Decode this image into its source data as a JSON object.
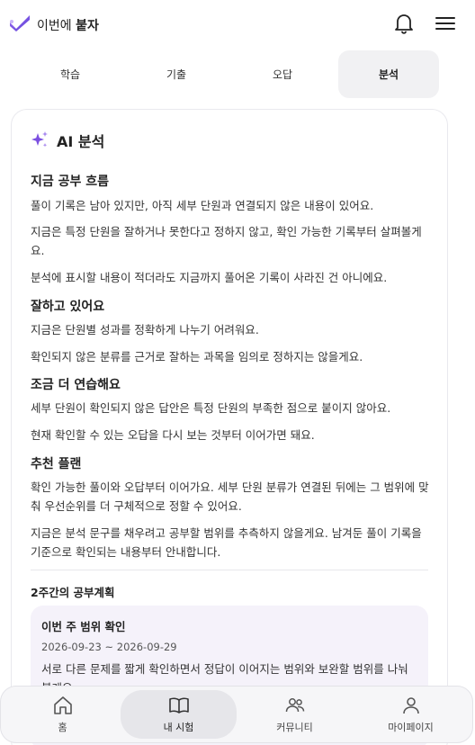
{
  "header": {
    "logo_prefix": "이번에",
    "logo_bold": "붙자",
    "bell_icon": "bell-icon",
    "menu_icon": "hamburger-menu-icon"
  },
  "tabs": [
    {
      "label": "학습",
      "active": false
    },
    {
      "label": "기출",
      "active": false
    },
    {
      "label": "오답",
      "active": false
    },
    {
      "label": "분석",
      "active": true
    }
  ],
  "card": {
    "title": "AI 분석",
    "icon": "sparkle-icon",
    "sections": [
      {
        "title": "지금 공부 흐름",
        "paragraphs": [
          "풀이 기록은 남아 있지만, 아직 세부 단원과 연결되지 않은 내용이 있어요.",
          "지금은 특정 단원을 잘하거나 못한다고 정하지 않고, 확인 가능한 기록부터 살펴볼게요.",
          "분석에 표시할 내용이 적더라도 지금까지 풀어온 기록이 사라진 건 아니에요."
        ]
      },
      {
        "title": "잘하고 있어요",
        "paragraphs": [
          "지금은 단원별 성과를 정확하게 나누기 어려워요.",
          "확인되지 않은 분류를 근거로 잘하는 과목을 임의로 정하지는 않을게요."
        ]
      },
      {
        "title": "조금 더 연습해요",
        "paragraphs": [
          "세부 단원이 확인되지 않은 답안은 특정 단원의 부족한 점으로 붙이지 않아요.",
          "현재 확인할 수 있는 오답을 다시 보는 것부터 이어가면 돼요."
        ]
      },
      {
        "title": "추천 플랜",
        "paragraphs": [
          "확인 가능한 풀이와 오답부터 이어가요. 세부 단원 분류가 연결된 뒤에는 그 범위에 맞춰 우선순위를 더 구체적으로 정할 수 있어요.",
          "지금은 분석 문구를 채우려고 공부할 범위를 추측하지 않을게요. 남겨둔 풀이 기록을 기준으로 확인되는 내용부터 안내합니다."
        ]
      }
    ],
    "plan": {
      "section_title": "2주간의 공부계획",
      "heading": "이번 주 범위 확인",
      "date_range": "2026-09-23 ~ 2026-09-29",
      "description": "서로 다른 문제를 짧게 확인하면서 정답이 이어지는 범위와 보완할 범위를 나눠 볼게요."
    }
  },
  "bottom_nav": [
    {
      "label": "홈",
      "icon": "home-icon",
      "active": false
    },
    {
      "label": "내 시험",
      "icon": "book-icon",
      "active": true
    },
    {
      "label": "커뮤니티",
      "icon": "community-icon",
      "active": false
    },
    {
      "label": "마이페이지",
      "icon": "user-icon",
      "active": false
    }
  ],
  "colors": {
    "accent": "#7b4fe0",
    "active_tab_bg": "#f1f1f3",
    "plan_bg": "#f5f2fa"
  }
}
